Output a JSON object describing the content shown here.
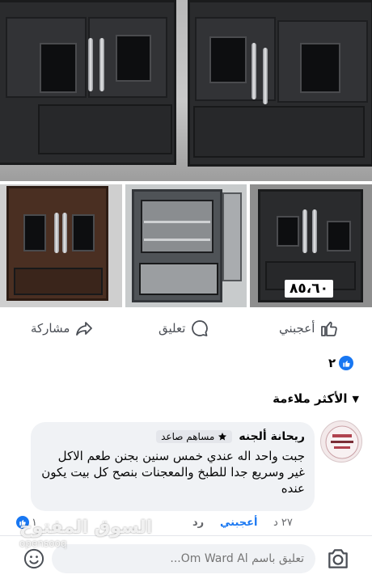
{
  "post": {
    "price_badge": "٨٥،٦٠"
  },
  "actions": {
    "like_label": "أعجبني",
    "comment_label": "تعليق",
    "share_label": "مشاركة"
  },
  "reactions": {
    "count": "٢"
  },
  "sort": {
    "label": "الأكثر ملاءمة"
  },
  "comment": {
    "author": "ريحانة ألجنه",
    "badge": "مساهم صاعد",
    "text": "جبت واحد اله عندي خمس سنين بجنن طعم الاكل غير وسريع جدا للطبخ والمعجنات بنصح كل بيت يكون عنده",
    "time": "٢٧ د",
    "like_action": "أعجبني",
    "reply_action": "رد",
    "likes_count": "١"
  },
  "composer": {
    "placeholder": "تعليق باسم Om Ward Al..."
  },
  "watermark": {
    "line1": "السوق المفتوح",
    "line2": "opensooq"
  },
  "colors": {
    "accent": "#1877f2",
    "text": "#050505",
    "muted": "#65676b"
  }
}
